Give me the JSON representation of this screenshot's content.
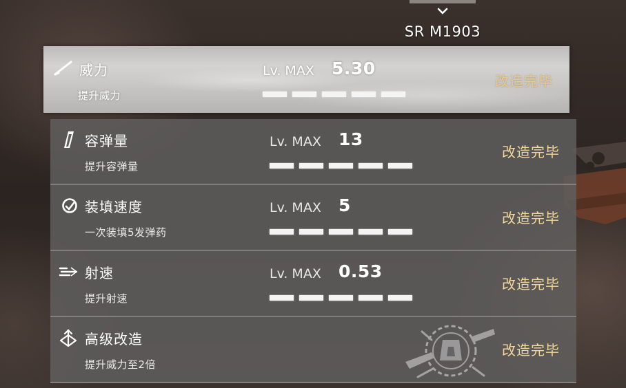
{
  "header": {
    "weapon_name": "SR M1903"
  },
  "rows": [
    {
      "icon": "rifle-barrel-icon",
      "title": "威力",
      "subtitle": "提升威力",
      "level_label": "Lv. MAX",
      "value": "5.30",
      "pips_filled": 5,
      "pips_total": 5,
      "status": "改造完毕",
      "selected": true
    },
    {
      "icon": "magazine-icon",
      "title": "容弹量",
      "subtitle": "提升容弹量",
      "level_label": "Lv. MAX",
      "value": "13",
      "pips_filled": 5,
      "pips_total": 5,
      "status": "改造完毕",
      "selected": false
    },
    {
      "icon": "reload-icon",
      "title": "装填速度",
      "subtitle": "一次装填5发弹药",
      "level_label": "Lv. MAX",
      "value": "5",
      "pips_filled": 5,
      "pips_total": 5,
      "status": "改造完毕",
      "selected": false
    },
    {
      "icon": "fire-rate-icon",
      "title": "射速",
      "subtitle": "提升射速",
      "level_label": "Lv. MAX",
      "value": "0.53",
      "pips_filled": 5,
      "pips_total": 5,
      "status": "改造完毕",
      "selected": false
    },
    {
      "icon": "advanced-upgrade-icon",
      "title": "高级改造",
      "subtitle": "提升威力至2倍",
      "level_label": "",
      "value": "",
      "pips_filled": 0,
      "pips_total": 0,
      "status": "改造完毕",
      "selected": false
    }
  ],
  "colors": {
    "status_text": "#f2d79a",
    "row_background": "#605e5d",
    "selected_row_background": "#c9c8c6",
    "pip": "#f4f4f4"
  }
}
